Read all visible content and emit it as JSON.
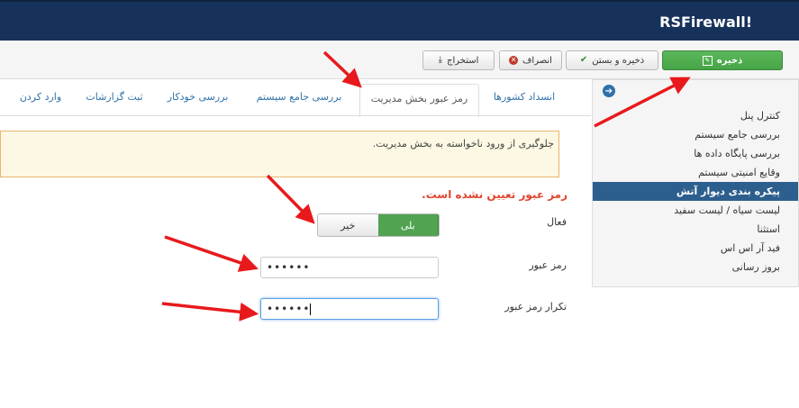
{
  "header": {
    "title": "RSFirewall!"
  },
  "toolbar": {
    "save_label": "ذخیره",
    "save_close_label": "ذخیره و بستن",
    "cancel_label": "انصراف",
    "export_label": "استخراج"
  },
  "sidebar": {
    "items": [
      {
        "label": "کنترل پنل"
      },
      {
        "label": "بررسی جامع سیستم"
      },
      {
        "label": "بررسی پایگاه داده ها"
      },
      {
        "label": "وقایع امنیتی سیستم"
      },
      {
        "label": "پیکره بندی دیوار آتش",
        "active": true
      },
      {
        "label": "لیست سیاه / لیست سفید"
      },
      {
        "label": "استثنا"
      },
      {
        "label": "فید آر اس اس"
      },
      {
        "label": "بروز رسانی"
      }
    ]
  },
  "tabs": [
    {
      "label": "انسداد کشورها"
    },
    {
      "label": "رمز عبور بخش مدیریت",
      "active": true
    },
    {
      "label": "بررسی جامع سیستم"
    },
    {
      "label": "بررسی خودکار"
    },
    {
      "label": "ثبت گزارشات"
    },
    {
      "label": "وارد کردن"
    }
  ],
  "alert": {
    "text": "جلوگیری از ورود ناخواسته به بخش مدیریت."
  },
  "form": {
    "error": "رمز عبور تعیین نشده است.",
    "enabled_label": "فعال",
    "toggle_no": "خیر",
    "toggle_yes": "بلی",
    "toggle_value": "بلی",
    "password_label": "رمز عبور",
    "password_value": "••••••",
    "confirm_label": "تکرار رمز عبور",
    "confirm_value": "••••••"
  },
  "colors": {
    "header_bg": "#17325a",
    "save_green": "#5bb75b",
    "active_menu": "#2d5f8e",
    "error_red": "#e0452e",
    "annotation_arrow": "#e8191c"
  }
}
